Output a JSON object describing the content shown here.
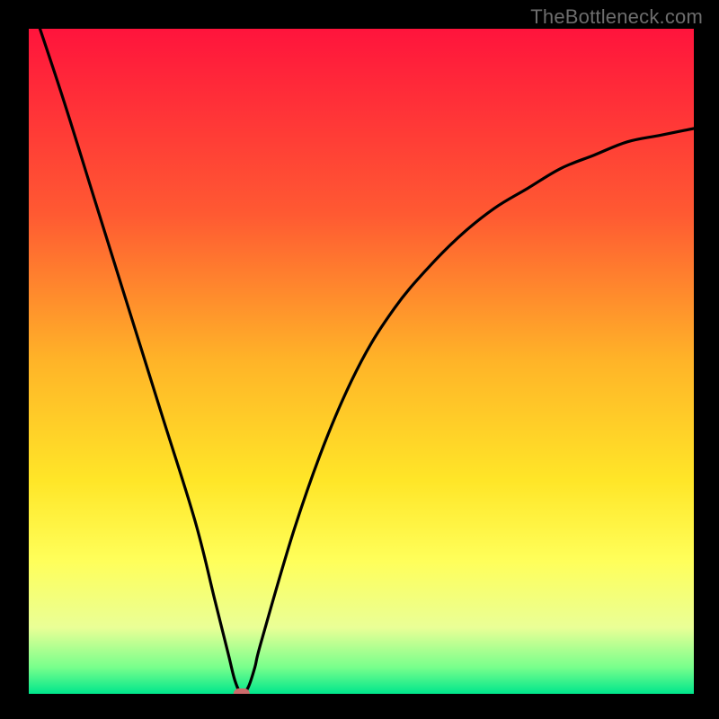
{
  "watermark": "TheBottleneck.com",
  "chart_data": {
    "type": "line",
    "title": "",
    "xlabel": "",
    "ylabel": "",
    "xlim": [
      0,
      100
    ],
    "ylim": [
      0,
      100
    ],
    "background_gradient_stops": [
      {
        "pos": 0.0,
        "color": "#ff143c"
      },
      {
        "pos": 0.28,
        "color": "#ff5a32"
      },
      {
        "pos": 0.5,
        "color": "#ffb428"
      },
      {
        "pos": 0.68,
        "color": "#ffe628"
      },
      {
        "pos": 0.8,
        "color": "#ffff5a"
      },
      {
        "pos": 0.9,
        "color": "#eaff96"
      },
      {
        "pos": 0.96,
        "color": "#78ff8c"
      },
      {
        "pos": 1.0,
        "color": "#00e68c"
      }
    ],
    "series": [
      {
        "name": "bottleneck-curve",
        "x": [
          0,
          5,
          10,
          15,
          20,
          25,
          28,
          30,
          31,
          32,
          33,
          34,
          35,
          40,
          45,
          50,
          55,
          60,
          65,
          70,
          75,
          80,
          85,
          90,
          95,
          100
        ],
        "values": [
          105,
          90,
          74,
          58,
          42,
          26,
          14,
          6,
          2,
          0,
          1,
          4,
          8,
          25,
          39,
          50,
          58,
          64,
          69,
          73,
          76,
          79,
          81,
          83,
          84,
          85
        ]
      }
    ],
    "marker": {
      "x": 32,
      "y": 0,
      "shape": "pill",
      "color": "#cc6b6b"
    }
  }
}
